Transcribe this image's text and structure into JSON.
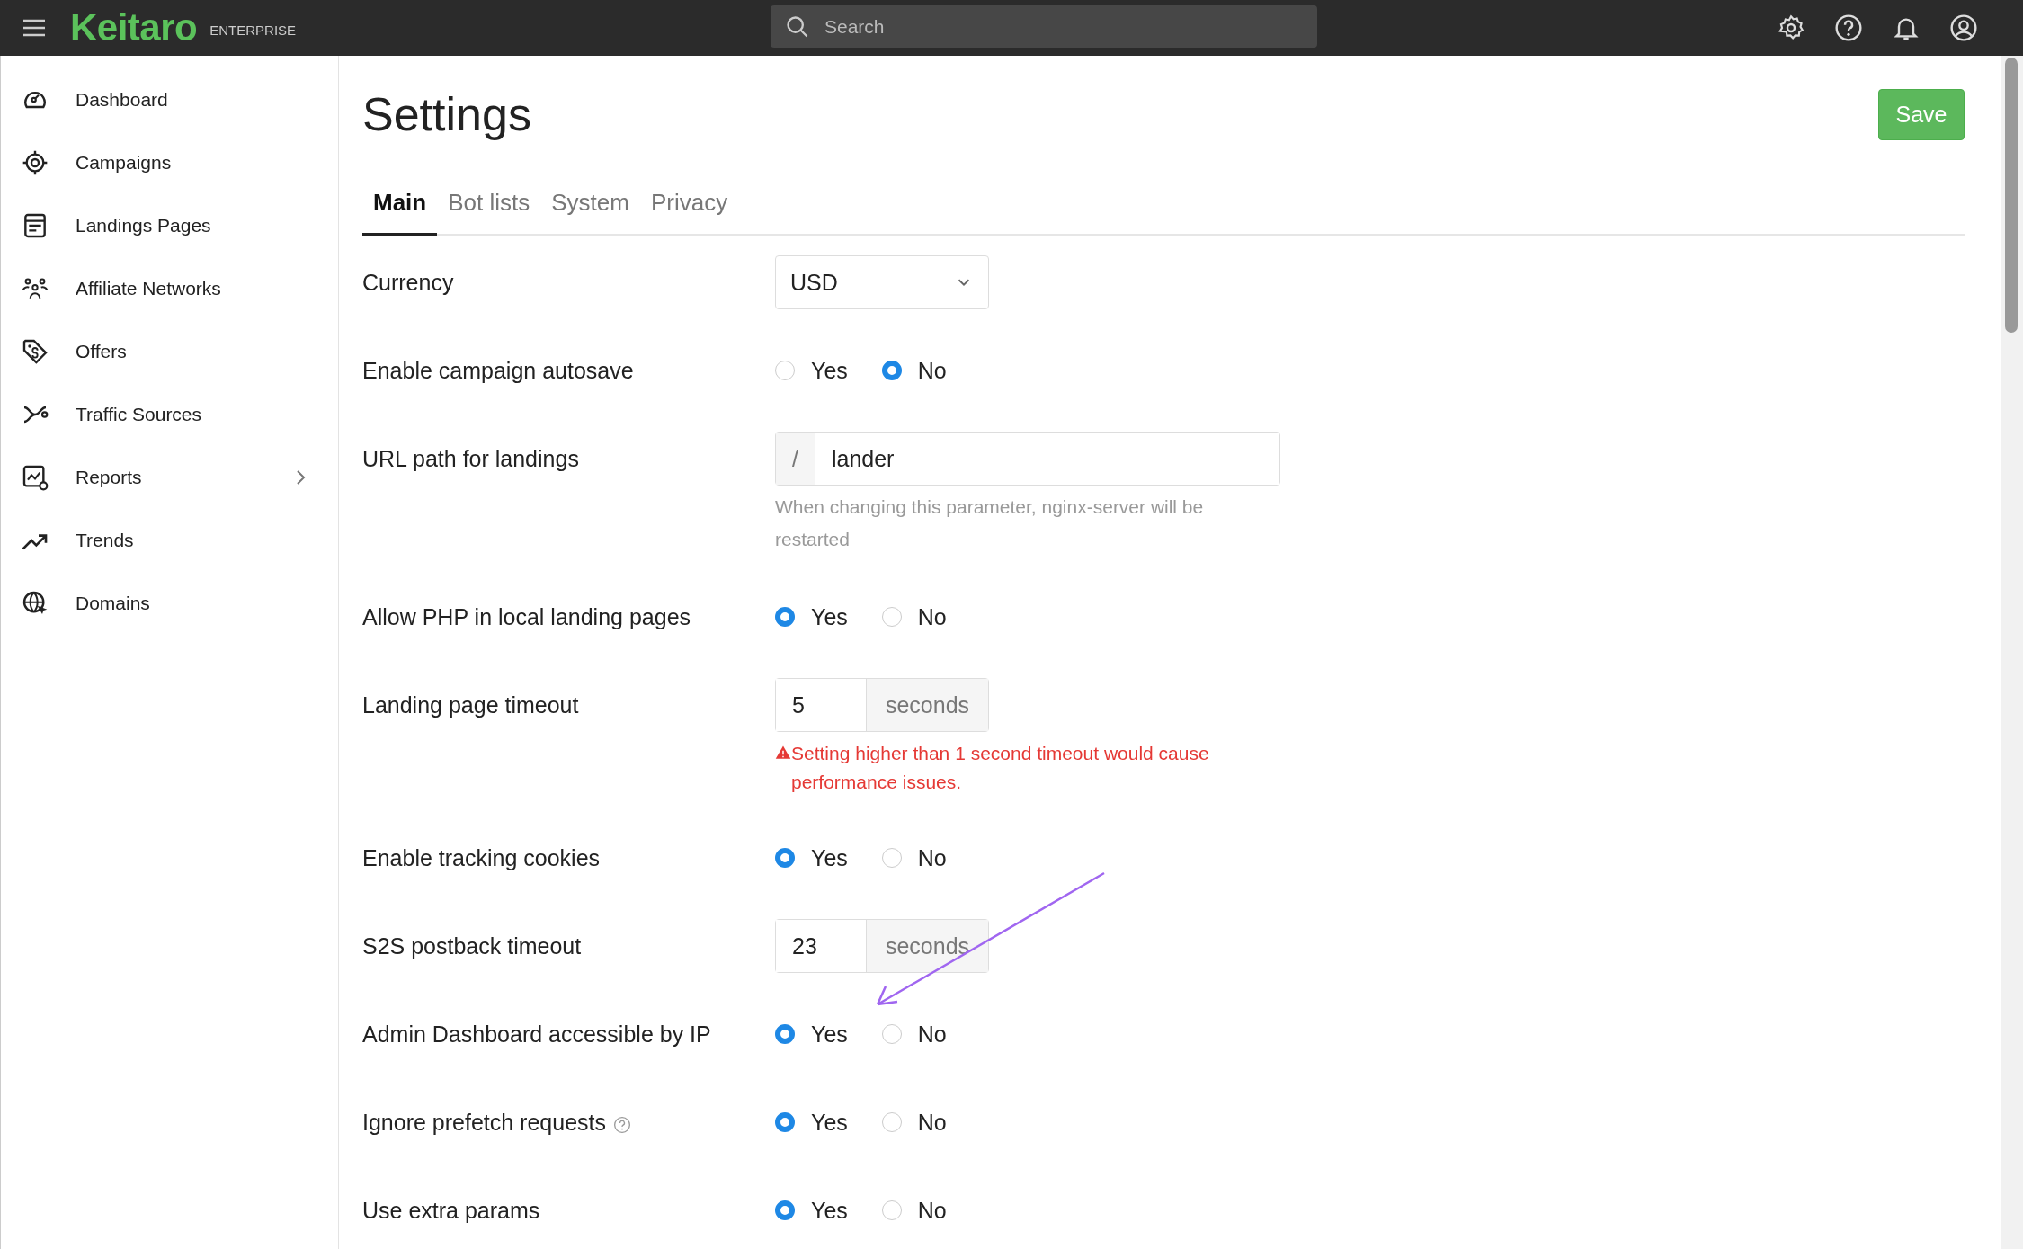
{
  "topbar": {
    "logo": "Keitaro",
    "edition": "ENTERPRISE",
    "search": {
      "placeholder": "Search"
    }
  },
  "sidebar": {
    "items": [
      {
        "label": "Dashboard",
        "has_submenu": false
      },
      {
        "label": "Campaigns",
        "has_submenu": false
      },
      {
        "label": "Landings Pages",
        "has_submenu": false
      },
      {
        "label": "Affiliate Networks",
        "has_submenu": false
      },
      {
        "label": "Offers",
        "has_submenu": false
      },
      {
        "label": "Traffic Sources",
        "has_submenu": false
      },
      {
        "label": "Reports",
        "has_submenu": true
      },
      {
        "label": "Trends",
        "has_submenu": false
      },
      {
        "label": "Domains",
        "has_submenu": false
      }
    ]
  },
  "page": {
    "title": "Settings",
    "save_button": "Save"
  },
  "tabs": [
    {
      "label": "Main",
      "selected": true
    },
    {
      "label": "Bot lists",
      "selected": false
    },
    {
      "label": "System",
      "selected": false
    },
    {
      "label": "Privacy",
      "selected": false
    }
  ],
  "settings": [
    {
      "kind": "select",
      "label": "Currency",
      "value": "USD"
    },
    {
      "kind": "radio",
      "label": "Enable campaign autosave",
      "options": [
        {
          "label": "Yes",
          "selected": false
        },
        {
          "label": "No",
          "selected": true
        }
      ]
    },
    {
      "kind": "prefix-input",
      "label": "URL path for landings",
      "prefix": "/",
      "value": "lander",
      "note": "When changing this parameter, nginx-server will be restarted"
    },
    {
      "kind": "radio",
      "label": "Allow PHP in local landing pages",
      "options": [
        {
          "label": "Yes",
          "selected": true
        },
        {
          "label": "No",
          "selected": false
        }
      ]
    },
    {
      "kind": "suffix-input",
      "label": "Landing page timeout",
      "value": "5",
      "suffix": "seconds",
      "warning": "Setting higher than 1 second timeout would cause performance issues."
    },
    {
      "kind": "radio",
      "label": "Enable tracking cookies",
      "options": [
        {
          "label": "Yes",
          "selected": true
        },
        {
          "label": "No",
          "selected": false
        }
      ]
    },
    {
      "kind": "suffix-input",
      "label": "S2S postback timeout",
      "value": "23",
      "suffix": "seconds"
    },
    {
      "kind": "radio",
      "label": "Admin Dashboard accessible by IP",
      "options": [
        {
          "label": "Yes",
          "selected": true
        },
        {
          "label": "No",
          "selected": false
        }
      ]
    },
    {
      "kind": "radio",
      "label": "Ignore prefetch requests",
      "help": true,
      "options": [
        {
          "label": "Yes",
          "selected": true
        },
        {
          "label": "No",
          "selected": false
        }
      ]
    },
    {
      "kind": "radio",
      "label": "Use extra params",
      "options": [
        {
          "label": "Yes",
          "selected": true
        },
        {
          "label": "No",
          "selected": false
        }
      ]
    }
  ]
}
